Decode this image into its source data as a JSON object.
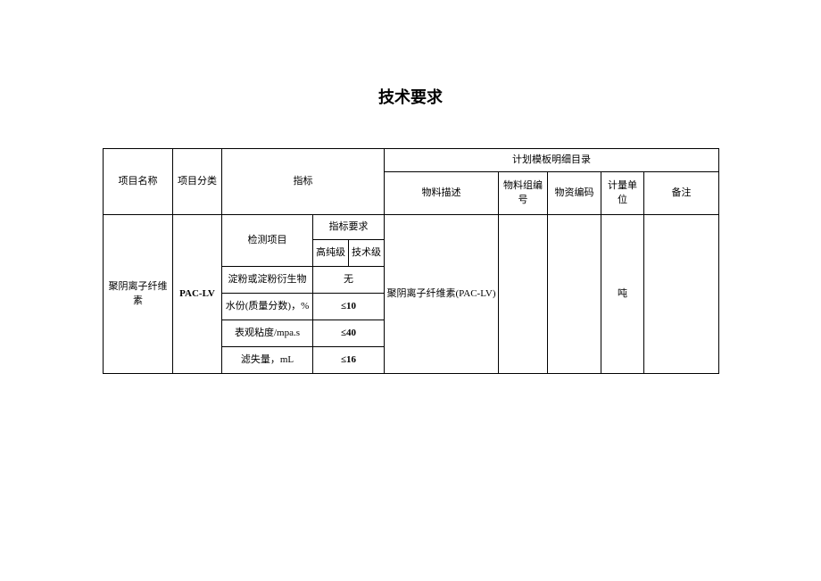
{
  "title": "技术要求",
  "header": {
    "col_project_name": "项目名称",
    "col_project_class": "项目分类",
    "col_indicator": "指标",
    "col_plan_template": "计划模板明细目录",
    "col_material_desc": "物料描述",
    "col_material_group_no": "物料组编号",
    "col_material_code": "物资编码",
    "col_unit": "计量单位",
    "col_remark": "备注"
  },
  "row": {
    "project_name": "聚阴离子纤维素",
    "project_class": "PAC-LV",
    "test_item_label": "检测项目",
    "req_label": "指标要求",
    "grade_high": "高纯级",
    "grade_tech": "技术级",
    "material_desc": "聚阴离子纤维素(PAC-LV)",
    "material_group_no": "",
    "material_code": "",
    "unit": "吨",
    "remark": ""
  },
  "chart_data": {
    "type": "table",
    "title": "技术要求",
    "columns": [
      "检测项目",
      "指标要求"
    ],
    "rows": [
      {
        "item": "淀粉或淀粉衍生物",
        "req": "无"
      },
      {
        "item": "水份(质量分数)，%",
        "req": "≤10"
      },
      {
        "item": "表观粘度/mpa.s",
        "req": "≤40"
      },
      {
        "item": "滤失量，mL",
        "req": "≤16"
      }
    ]
  }
}
